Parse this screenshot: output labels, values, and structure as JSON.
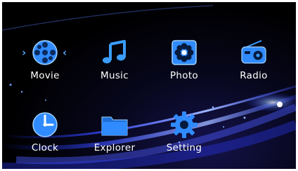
{
  "menu": {
    "items": [
      {
        "label": "Movie",
        "icon": "film-reel-icon"
      },
      {
        "label": "Music",
        "icon": "music-note-icon"
      },
      {
        "label": "Photo",
        "icon": "flower-icon"
      },
      {
        "label": "Radio",
        "icon": "radio-icon"
      },
      {
        "label": "Clock",
        "icon": "clock-icon"
      },
      {
        "label": "Explorer",
        "icon": "folder-icon"
      },
      {
        "label": "Setting",
        "icon": "gear-icon"
      }
    ],
    "selected": "Movie",
    "selection_markers": [
      "›",
      "‹"
    ]
  },
  "colors": {
    "background": "#000000",
    "accent": "#2f8bff",
    "icon_blue": "#3a9dff",
    "label": "#ffffff"
  }
}
